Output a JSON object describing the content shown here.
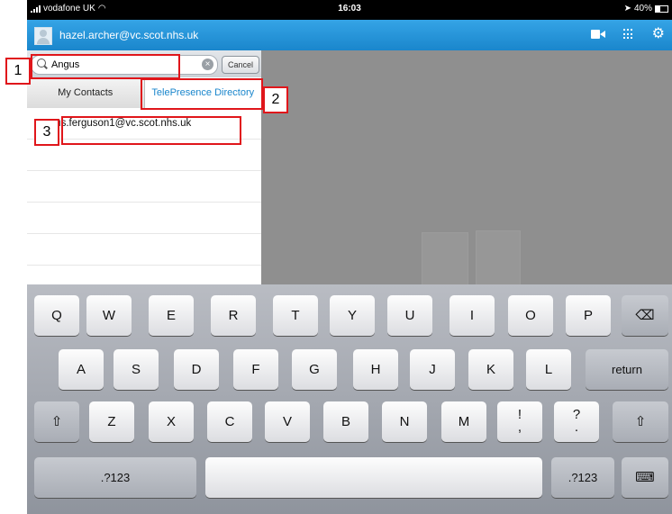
{
  "status_bar": {
    "carrier": "vodafone UK",
    "time": "16:03",
    "battery": "40%"
  },
  "header": {
    "user": "hazel.archer@vc.scot.nhs.uk",
    "icons": [
      "video-camera-icon",
      "keypad-icon",
      "gear-icon"
    ]
  },
  "search": {
    "value": "Angus",
    "cancel_label": "Cancel"
  },
  "tabs": [
    {
      "label": "My Contacts",
      "active": false
    },
    {
      "label": "TelePresence Directory",
      "active": true
    }
  ],
  "results": [
    {
      "label": "angus.ferguson1@vc.scot.nhs.uk"
    }
  ],
  "keyboard": {
    "row1": [
      "Q",
      "W",
      "E",
      "R",
      "T",
      "Y",
      "U",
      "I",
      "O",
      "P"
    ],
    "row2": [
      "A",
      "S",
      "D",
      "F",
      "G",
      "H",
      "J",
      "K",
      "L"
    ],
    "row3": [
      "Z",
      "X",
      "C",
      "V",
      "B",
      "N",
      "M"
    ],
    "return_label": "return",
    "numbers_label": ".?123",
    "punct1": [
      "!",
      ","
    ],
    "punct2": [
      "?",
      "."
    ]
  },
  "annotations": [
    "1",
    "2",
    "3"
  ],
  "colors": {
    "accent": "#1a86cc",
    "annotation": "#e0161b"
  }
}
